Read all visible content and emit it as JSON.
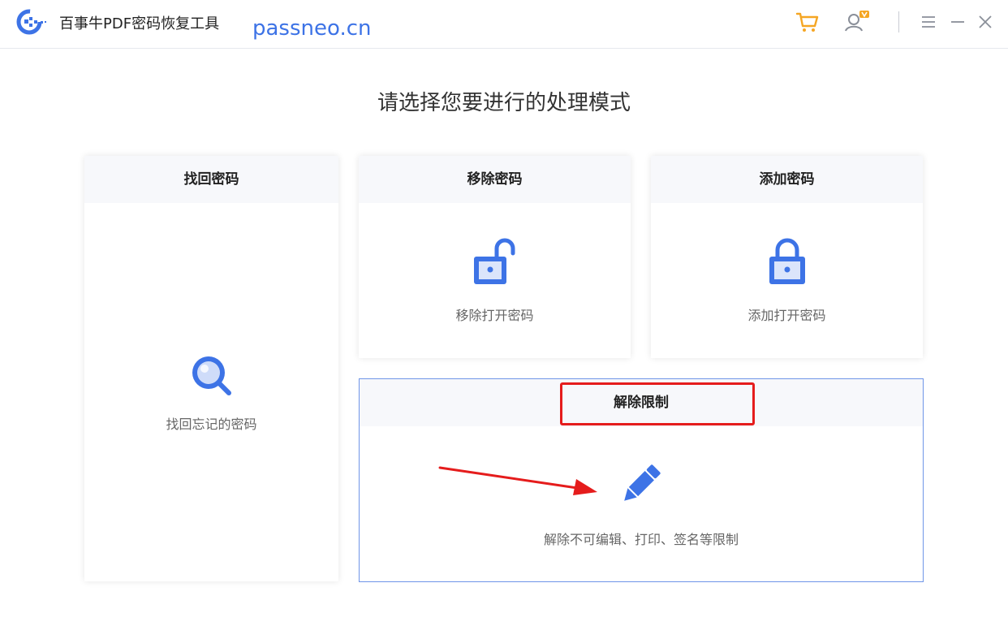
{
  "app": {
    "title": "百事牛PDF密码恢复工具",
    "watermark": "passneo.cn",
    "accent_color": "#3d73e6"
  },
  "toolbar": {
    "icons": [
      "cart-icon",
      "user-vip-icon",
      "menu-icon",
      "minimize-icon",
      "close-icon"
    ]
  },
  "main": {
    "prompt": "请选择您要进行的处理模式",
    "cards": {
      "recover": {
        "title": "找回密码",
        "desc": "找回忘记的密码",
        "icon": "magnifier-icon"
      },
      "remove": {
        "title": "移除密码",
        "desc": "移除打开密码",
        "icon": "unlocked-padlock-icon"
      },
      "add": {
        "title": "添加密码",
        "desc": "添加打开密码",
        "icon": "locked-padlock-icon"
      },
      "unlock": {
        "title": "解除限制",
        "desc": "解除不可编辑、打印、签名等限制",
        "icon": "pencil-icon"
      }
    }
  },
  "annotations": {
    "highlight_color": "#e51c1c"
  }
}
